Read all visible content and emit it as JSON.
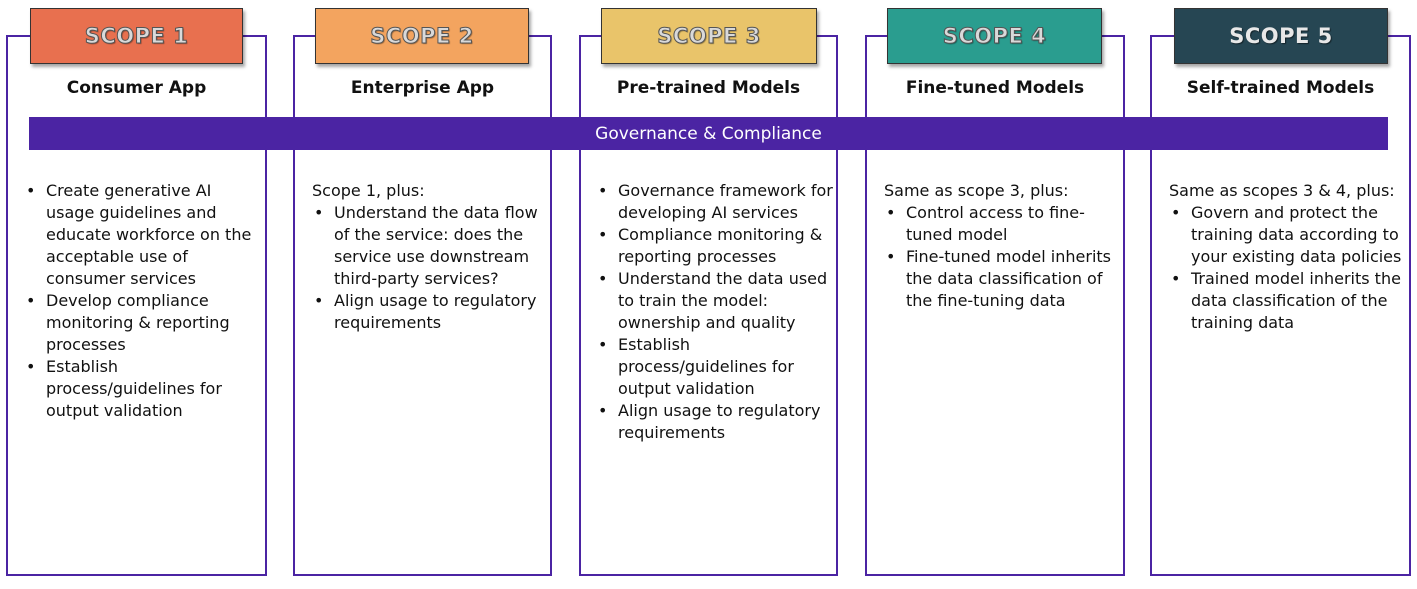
{
  "governance_bar": {
    "label": "Governance & Compliance",
    "color": "#4b24a3"
  },
  "scopes": [
    {
      "tab_label": "SCOPE 1",
      "tab_color": "#e8704f",
      "title": "Consumer App",
      "intro": "",
      "bullets": [
        "Create generative AI usage guidelines and educate workforce on the acceptable use of consumer services",
        "Develop compliance monitoring & reporting processes",
        "Establish process/guidelines for output validation"
      ]
    },
    {
      "tab_label": "SCOPE 2",
      "tab_color": "#f3a45f",
      "title": "Enterprise App",
      "intro": "Scope 1, plus:",
      "bullets": [
        "Understand the data flow of the service: does the service use downstream third-party services?",
        "Align usage to regulatory requirements"
      ]
    },
    {
      "tab_label": "SCOPE 3",
      "tab_color": "#e9c46a",
      "title": "Pre-trained Models",
      "intro": "",
      "bullets": [
        "Governance framework for developing AI services",
        "Compliance monitoring & reporting processes",
        "Understand the data used to train the model: ownership and quality",
        "Establish process/guidelines for output validation",
        "Align usage to regulatory requirements"
      ]
    },
    {
      "tab_label": "SCOPE 4",
      "tab_color": "#2a9d8f",
      "title": "Fine-tuned Models",
      "intro": "Same as scope 3, plus:",
      "bullets": [
        "Control access to fine-tuned model",
        "Fine-tuned model inherits the data classification of the fine-tuning data"
      ]
    },
    {
      "tab_label": "SCOPE 5",
      "tab_color": "#264653",
      "title": "Self-trained Models",
      "intro": "Same as scopes 3 & 4, plus:",
      "bullets": [
        "Govern and protect the training data according to your existing data policies",
        "Trained model inherits the data classification of the training data"
      ]
    }
  ],
  "bullet_glyph": "•",
  "border_color": "#4b24a3"
}
